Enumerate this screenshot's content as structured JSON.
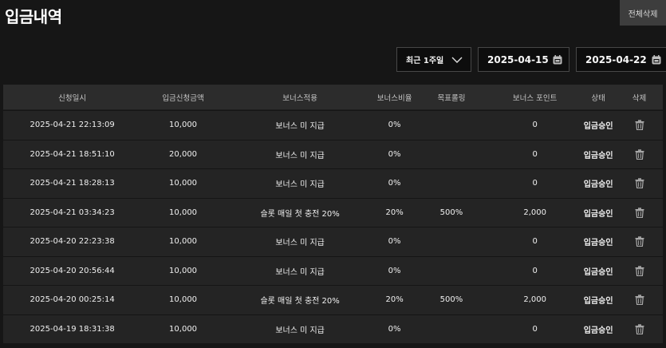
{
  "page": {
    "title": "입금내역",
    "delete_all_label": "전체삭제"
  },
  "filters": {
    "period_label": "최근 1주일",
    "start_date": "2025-04-15",
    "end_date": "2025-04-22"
  },
  "table": {
    "columns": [
      "신청일시",
      "입금신청금액",
      "보너스적용",
      "보너스비율",
      "목표롤링",
      "보너스 포인트",
      "상태",
      "삭제"
    ],
    "rows": [
      {
        "datetime": "2025-04-21 22:13:09",
        "amount": "10,000",
        "bonus_applied": "보너스 미 지급",
        "bonus_rate": "0%",
        "target_rolling": "",
        "bonus_points": "0",
        "status": "입금승인"
      },
      {
        "datetime": "2025-04-21 18:51:10",
        "amount": "20,000",
        "bonus_applied": "보너스 미 지급",
        "bonus_rate": "0%",
        "target_rolling": "",
        "bonus_points": "0",
        "status": "입금승인"
      },
      {
        "datetime": "2025-04-21 18:28:13",
        "amount": "10,000",
        "bonus_applied": "보너스 미 지급",
        "bonus_rate": "0%",
        "target_rolling": "",
        "bonus_points": "0",
        "status": "입금승인"
      },
      {
        "datetime": "2025-04-21 03:34:23",
        "amount": "10,000",
        "bonus_applied": "슬롯 매일 첫 충전 20%",
        "bonus_rate": "20%",
        "target_rolling": "500%",
        "bonus_points": "2,000",
        "status": "입금승인"
      },
      {
        "datetime": "2025-04-20 22:23:38",
        "amount": "10,000",
        "bonus_applied": "보너스 미 지급",
        "bonus_rate": "0%",
        "target_rolling": "",
        "bonus_points": "0",
        "status": "입금승인"
      },
      {
        "datetime": "2025-04-20 20:56:44",
        "amount": "10,000",
        "bonus_applied": "보너스 미 지급",
        "bonus_rate": "0%",
        "target_rolling": "",
        "bonus_points": "0",
        "status": "입금승인"
      },
      {
        "datetime": "2025-04-20 00:25:14",
        "amount": "10,000",
        "bonus_applied": "슬롯 매일 첫 충전 20%",
        "bonus_rate": "20%",
        "target_rolling": "500%",
        "bonus_points": "2,000",
        "status": "입금승인"
      },
      {
        "datetime": "2025-04-19 18:31:38",
        "amount": "10,000",
        "bonus_applied": "보너스 미 지급",
        "bonus_rate": "0%",
        "target_rolling": "",
        "bonus_points": "0",
        "status": "입금승인"
      }
    ]
  },
  "icons": {
    "period_select": "chevron-down-icon",
    "date_picker": "calendar-icon",
    "row_delete": "trash-icon"
  }
}
